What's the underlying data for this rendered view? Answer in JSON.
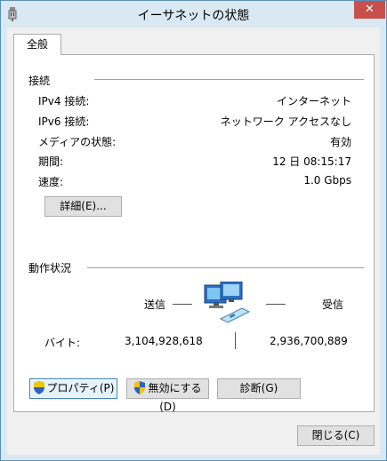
{
  "window": {
    "title": "イーサネットの状態",
    "close_label": "✕"
  },
  "tabs": [
    {
      "label": "全般"
    }
  ],
  "connection": {
    "heading": "接続",
    "rows": [
      {
        "label": "IPv4 接続:",
        "value": "インターネット"
      },
      {
        "label": "IPv6 接続:",
        "value": "ネットワーク アクセスなし"
      },
      {
        "label": "メディアの状態:",
        "value": "有効"
      },
      {
        "label": "期間:",
        "value": "12 日 08:15:17"
      },
      {
        "label": "速度:",
        "value": "1.0 Gbps"
      }
    ],
    "details_button": "詳細(E)..."
  },
  "activity": {
    "heading": "動作状況",
    "sent_label": "送信",
    "received_label": "受信",
    "bytes_label": "バイト:",
    "bytes_sent": "3,104,928,618",
    "bytes_received": "2,936,700,889"
  },
  "buttons": {
    "properties": "プロパティ(P)",
    "disable": "無効にする(D)",
    "diagnose": "診断(G)",
    "close": "閉じる(C)"
  },
  "colors": {
    "title_bar": "#d9e8f2",
    "close_button": "#c7504b",
    "panel": "#ffffff",
    "dialog_bg": "#f0f0f0"
  },
  "icons": [
    "network-adapter-icon",
    "network-activity-icon",
    "shield-icon",
    "close-icon"
  ]
}
